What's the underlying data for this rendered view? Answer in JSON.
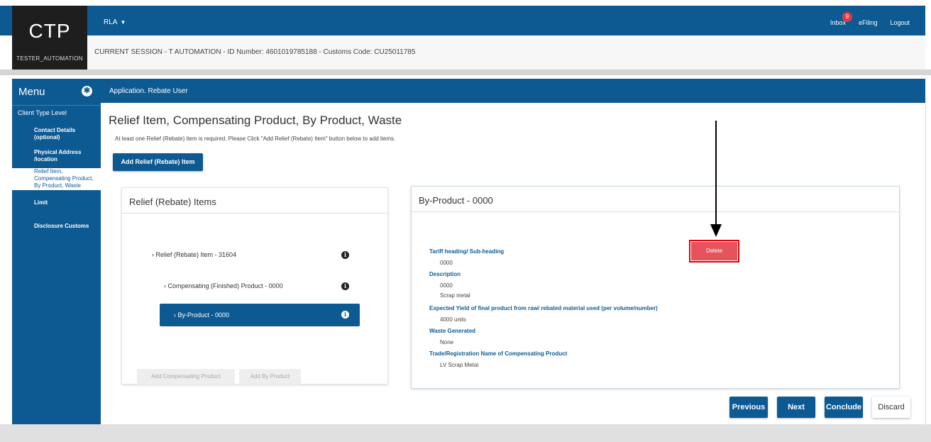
{
  "header": {
    "logo": "CTP",
    "logo_sub": "TESTER_AUTOMATION",
    "role_menu": "RLA",
    "inbox_label": "Inbox",
    "inbox_count": "9",
    "efiling_label": "eFiling",
    "logout_label": "Logout",
    "session_text": "CURRENT SESSION - T AUTOMATION - ID Number: 4601019785188 - Customs Code: CU25011785"
  },
  "sidebar": {
    "title": "Menu",
    "section": "Client Type Level",
    "items": [
      {
        "label": "Contact Details (optional)"
      },
      {
        "label": "Physical Address /location"
      },
      {
        "label": "Relief Item, Compensating Product, By Product, Waste"
      },
      {
        "label": "Limit"
      },
      {
        "label": "Disclosure Customs"
      }
    ]
  },
  "appbar": {
    "title": "Application. Rebate User"
  },
  "main": {
    "title": "Relief Item, Compensating Product, By Product, Waste",
    "notice": "At least one Relief (Rebate) item is required. Please Click \"Add Relief (Rebate) Item\" button below to add items.",
    "add_button": "Add Relief (Rebate) Item"
  },
  "left_panel": {
    "title": "Relief (Rebate) Items",
    "tree": [
      {
        "label": "Relief (Rebate) Item - 31604"
      },
      {
        "label": "Compensating (Finished) Product - 0000"
      },
      {
        "label": "By-Product - 0000"
      }
    ],
    "add_compensating": "Add Compensating Product",
    "add_by_product": "Add By Product"
  },
  "right_panel": {
    "title": "By-Product - 0000",
    "delete_label": "Delete",
    "fields": [
      {
        "label": "Tariff heading/ Sub-heading",
        "value": "0000"
      },
      {
        "label": "Description",
        "value": "0000",
        "value2": "Scrap metal"
      },
      {
        "label": "Expected Yield of final product from raw/ rebated material used (per volume/number)",
        "value": "4000 units"
      },
      {
        "label": "Waste Generated",
        "value": "None"
      },
      {
        "label": "Trade/Registration Name of Compensating Product",
        "value": "LV Scrap Metal"
      }
    ]
  },
  "footer": {
    "previous": "Previous",
    "next": "Next",
    "conclude": "Conclude",
    "discard": "Discard"
  },
  "colors": {
    "primary": "#0d5a93",
    "delete": "#e8525c",
    "badge": "#e63946"
  }
}
